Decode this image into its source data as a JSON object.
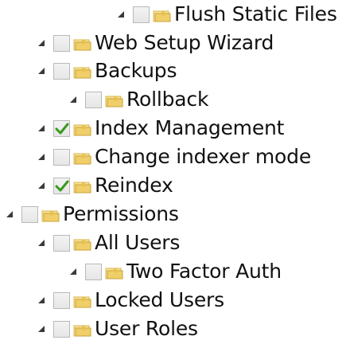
{
  "tree": {
    "nodes": [
      {
        "label": "Flush Static Files",
        "checked": false,
        "expanded": true
      },
      {
        "label": "Web Setup Wizard",
        "checked": false,
        "expanded": true
      },
      {
        "label": "Backups",
        "checked": false,
        "expanded": true
      },
      {
        "label": "Rollback",
        "checked": false,
        "expanded": true
      },
      {
        "label": "Index Management",
        "checked": true,
        "expanded": true
      },
      {
        "label": "Change indexer mode",
        "checked": false,
        "expanded": true
      },
      {
        "label": "Reindex",
        "checked": true,
        "expanded": true
      },
      {
        "label": "Permissions",
        "checked": false,
        "expanded": true
      },
      {
        "label": "All Users",
        "checked": false,
        "expanded": true
      },
      {
        "label": "Two Factor Auth",
        "checked": false,
        "expanded": true
      },
      {
        "label": "Locked Users",
        "checked": false,
        "expanded": true
      },
      {
        "label": "User Roles",
        "checked": false,
        "expanded": true
      }
    ]
  },
  "colors": {
    "check": "#3a9a1e",
    "folder_light": "#f7e39a",
    "folder_dark": "#d9b44a"
  },
  "icons": {
    "expander": "expand-arrow-icon",
    "folder": "folder-icon",
    "checkmark": "checkmark-icon"
  }
}
